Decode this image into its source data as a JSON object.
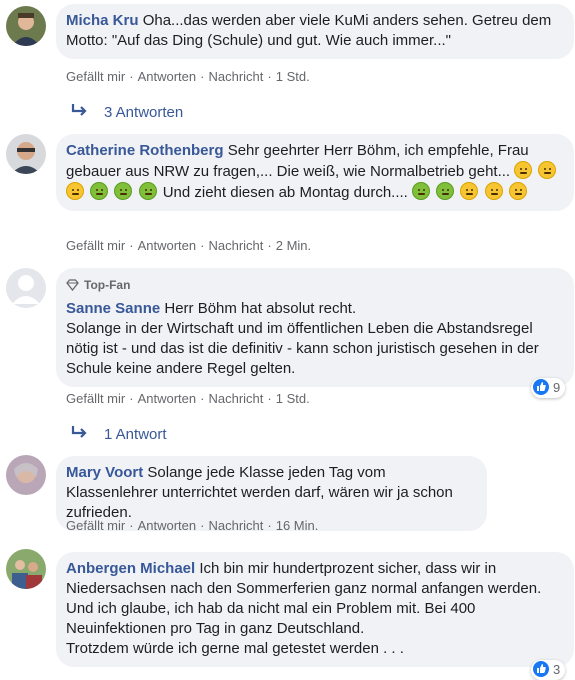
{
  "comments": [
    {
      "author": "Micha Kru",
      "text": "Oha...das werden aber viele KuMi anders sehen. Getreu dem Motto: \"Auf das Ding (Schule) und gut. Wie auch immer...\"",
      "time": "1 Std.",
      "replies": "3 Antworten"
    },
    {
      "author": "Catherine Rothenberg",
      "text_a": "Sehr geehrter Herr Böhm, ich empfehle, Frau gebauer aus NRW zu fragen,... Die weiß, wie Normalbetrieb geht...",
      "text_b": "Und zieht diesen ab Montag durch....",
      "time": "2 Min."
    },
    {
      "badge": "Top-Fan",
      "author": "Sanne Sanne",
      "text": "Herr Böhm hat absolut recht.",
      "text2": "Solange in der Wirtschaft und im öffentlichen Leben die Abstandsregel nötig ist - und das ist die definitiv - kann schon juristisch gesehen in der Schule keine andere Regel gelten.",
      "time": "1 Std.",
      "likes": "9",
      "replies": "1 Antwort"
    },
    {
      "author": "Mary Voort",
      "text": "Solange jede Klasse jeden Tag vom Klassenlehrer unterrichtet werden darf, wären wir ja schon zufrieden.",
      "time": "16 Min."
    },
    {
      "author": "Anbergen Michael",
      "text": "Ich bin mir hundertprozent sicher, dass wir in Niedersachsen nach den Sommerferien ganz normal anfangen werden. Und ich glaube, ich hab da nicht mal ein Problem mit. Bei 400 Neuinfektionen pro Tag in ganz Deutschland.",
      "text2": "Trotzdem würde ich gerne mal getestet werden . . .",
      "likes": "3"
    }
  ],
  "actions": {
    "like": "Gefällt mir",
    "reply": "Antworten",
    "message": "Nachricht",
    "dot": "·"
  },
  "colors": {
    "author": "#385898",
    "bubble": "#f0f2f5",
    "meta": "#65676b",
    "like_blue": "#1877f2"
  }
}
